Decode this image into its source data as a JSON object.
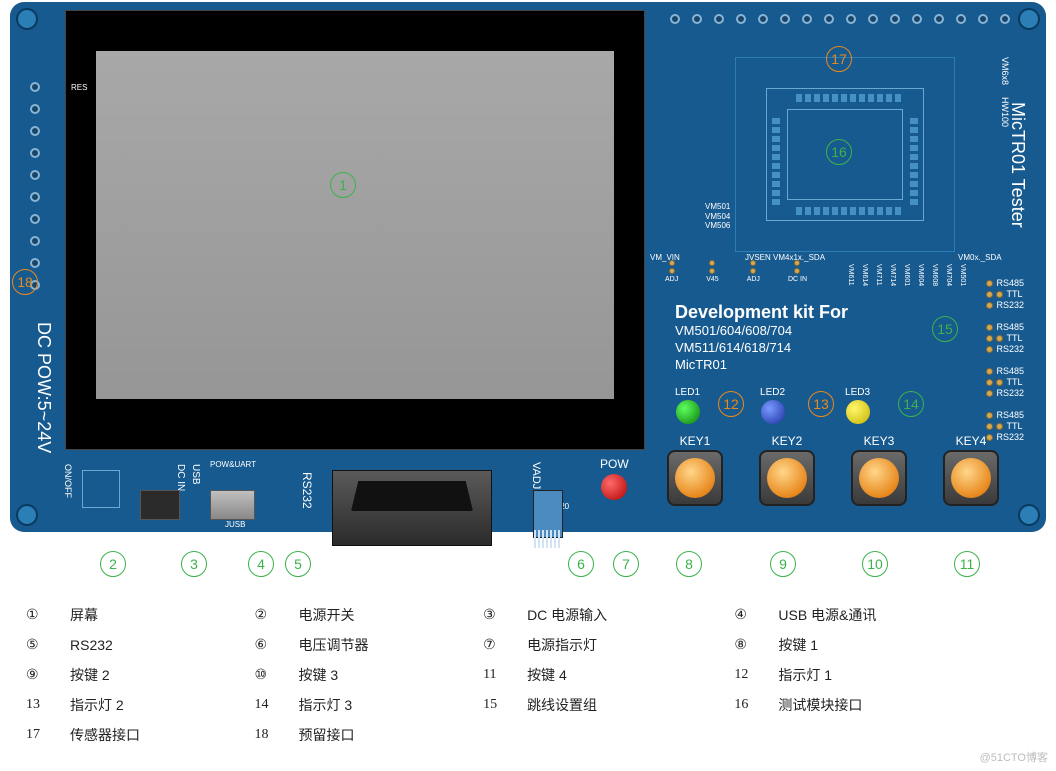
{
  "board": {
    "side_title": "MicTR01 Tester",
    "dc_pow_label": "DC POW:5~24V",
    "vm6x8": "VM6x8",
    "hw": "HW100",
    "res": "RES",
    "onoff": "ON/OFF",
    "dcin_usb": "USB",
    "dcin_dc": "DC IN",
    "usb_port_lbl": "JUSB",
    "pow_uart": "POW&UART",
    "rs232": "RS232",
    "vadj": "VADJ",
    "vadj_r": "R320",
    "pow": "POW",
    "dev_title": "Development kit For",
    "dev_line1": "VM501/604/608/704",
    "dev_line2": "VM511/614/618/714",
    "dev_line3": "MicTR01",
    "leds": [
      "LED1",
      "LED2",
      "LED3"
    ],
    "keys": [
      "KEY1",
      "KEY2",
      "KEY3",
      "KEY4"
    ],
    "jumper_top_lbls": [
      "ADJ",
      "V45",
      "ADJ",
      "DC IN"
    ],
    "jumper_silk_vmvin": "VM_VIN",
    "jumper_silk_jvsen": "JVSEN VM4x1x._SDA",
    "jumper_silk_vm0x": "VM0x._SDA",
    "chip_silk_lbls": "VM501\nVM504\nVM506",
    "vm_cols": [
      "VM611",
      "VM614",
      "VM711",
      "VM714",
      "VM601",
      "VM604",
      "VM608",
      "VM704",
      "VM501"
    ],
    "comm_lbls": [
      "RS485",
      "TTL",
      "RS232"
    ]
  },
  "callouts": {
    "1": "1",
    "2": "2",
    "3": "3",
    "4": "4",
    "5": "5",
    "6": "6",
    "7": "7",
    "8": "8",
    "9": "9",
    "10": "10",
    "11": "11",
    "12": "12",
    "13": "13",
    "14": "14",
    "15": "15",
    "16": "16",
    "17": "17",
    "18": "18"
  },
  "legend": [
    {
      "n": "①",
      "t": "屏幕"
    },
    {
      "n": "②",
      "t": "电源开关"
    },
    {
      "n": "③",
      "t": "DC 电源输入"
    },
    {
      "n": "④",
      "t": "USB 电源&通讯"
    },
    {
      "n": "⑤",
      "t": "RS232"
    },
    {
      "n": "⑥",
      "t": "电压调节器"
    },
    {
      "n": "⑦",
      "t": "电源指示灯"
    },
    {
      "n": "⑧",
      "t": "按键 1"
    },
    {
      "n": "⑨",
      "t": "按键 2"
    },
    {
      "n": "⑩",
      "t": "按键 3"
    },
    {
      "n": "11",
      "t": "按键 4"
    },
    {
      "n": "12",
      "t": "指示灯 1"
    },
    {
      "n": "13",
      "t": "指示灯 2"
    },
    {
      "n": "14",
      "t": "指示灯 3"
    },
    {
      "n": "15",
      "t": "跳线设置组"
    },
    {
      "n": "16",
      "t": "测试模块接口"
    },
    {
      "n": "17",
      "t": "传感器接口"
    },
    {
      "n": "18",
      "t": "预留接口"
    }
  ],
  "watermark": "@51CTO博客"
}
